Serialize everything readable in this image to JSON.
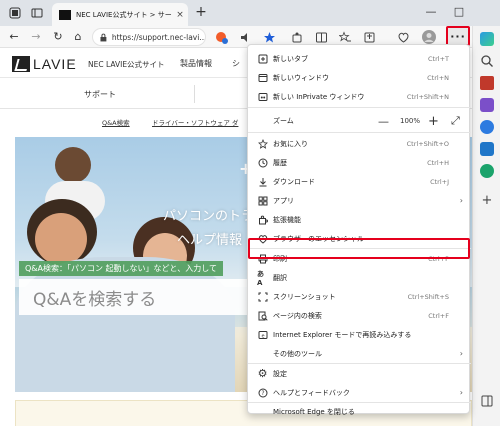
{
  "browser": {
    "tab_title": "NEC LAVIE公式サイト > サービス＆サ",
    "url": "https://support.nec-lavi...",
    "tab_close": "×",
    "new_tab": "+",
    "min": "—",
    "max": "□",
    "more_label": "···"
  },
  "page": {
    "logo_text": "LAVIE",
    "site_name": "NEC LAVIE公式サイト",
    "menu_product": "製品情報",
    "menu_cut": "シ",
    "support": "サポート",
    "sublinks": [
      "Q&A検索",
      "ドライバー・ソフトウェア ダ"
    ],
    "hero_line1": "パソコンのトラブ",
    "hero_line2": "ヘルプ情報",
    "hero_plus": "+",
    "qa_label": "Q&A検索：「パソコン 起動しない」などと、入力して",
    "qa_placeholder": "Q&Aを検索する"
  },
  "menu": {
    "items": [
      {
        "label": "新しいタブ",
        "shortcut": "Ctrl+T",
        "icon": "new-tab-icon"
      },
      {
        "label": "新しいウィンドウ",
        "shortcut": "Ctrl+N",
        "icon": "new-window-icon"
      },
      {
        "label": "新しい InPrivate ウィンドウ",
        "shortcut": "Ctrl+Shift+N",
        "icon": "inprivate-icon"
      },
      {
        "label": "お気に入り",
        "shortcut": "Ctrl+Shift+O",
        "icon": "favorites-icon"
      },
      {
        "label": "履歴",
        "shortcut": "Ctrl+H",
        "icon": "history-icon"
      },
      {
        "label": "ダウンロード",
        "shortcut": "Ctrl+J",
        "icon": "download-icon"
      },
      {
        "label": "アプリ",
        "shortcut": "",
        "icon": "apps-icon"
      },
      {
        "label": "拡張機能",
        "shortcut": "",
        "icon": "extensions-icon"
      },
      {
        "label": "ブラウザーのエッセンシャル",
        "shortcut": "",
        "icon": "essentials-icon"
      },
      {
        "label": "印刷",
        "shortcut": "Ctrl+P",
        "icon": "print-icon"
      },
      {
        "label": "翻訳",
        "shortcut": "",
        "icon": "translate-icon"
      },
      {
        "label": "スクリーンショット",
        "shortcut": "Ctrl+Shift+S",
        "icon": "screenshot-icon"
      },
      {
        "label": "ページ内の検索",
        "shortcut": "Ctrl+F",
        "icon": "find-icon"
      },
      {
        "label": "Internet Explorer モードで再読み込みする",
        "shortcut": "",
        "icon": "ie-mode-icon"
      },
      {
        "label": "その他のツール",
        "shortcut": "",
        "icon": ""
      },
      {
        "label": "設定",
        "shortcut": "",
        "icon": "settings-icon"
      },
      {
        "label": "ヘルプとフィードバック",
        "shortcut": "",
        "icon": "help-icon"
      },
      {
        "label": "Microsoft Edge を閉じる",
        "shortcut": "",
        "icon": ""
      }
    ],
    "zoom": {
      "label": "ズーム",
      "minus": "—",
      "value": "100%",
      "plus": "+",
      "fullscreen": "⤢"
    },
    "arrow": "›"
  },
  "colors": {
    "highlight": "#e5001d",
    "accent": "#0a5bd6"
  }
}
